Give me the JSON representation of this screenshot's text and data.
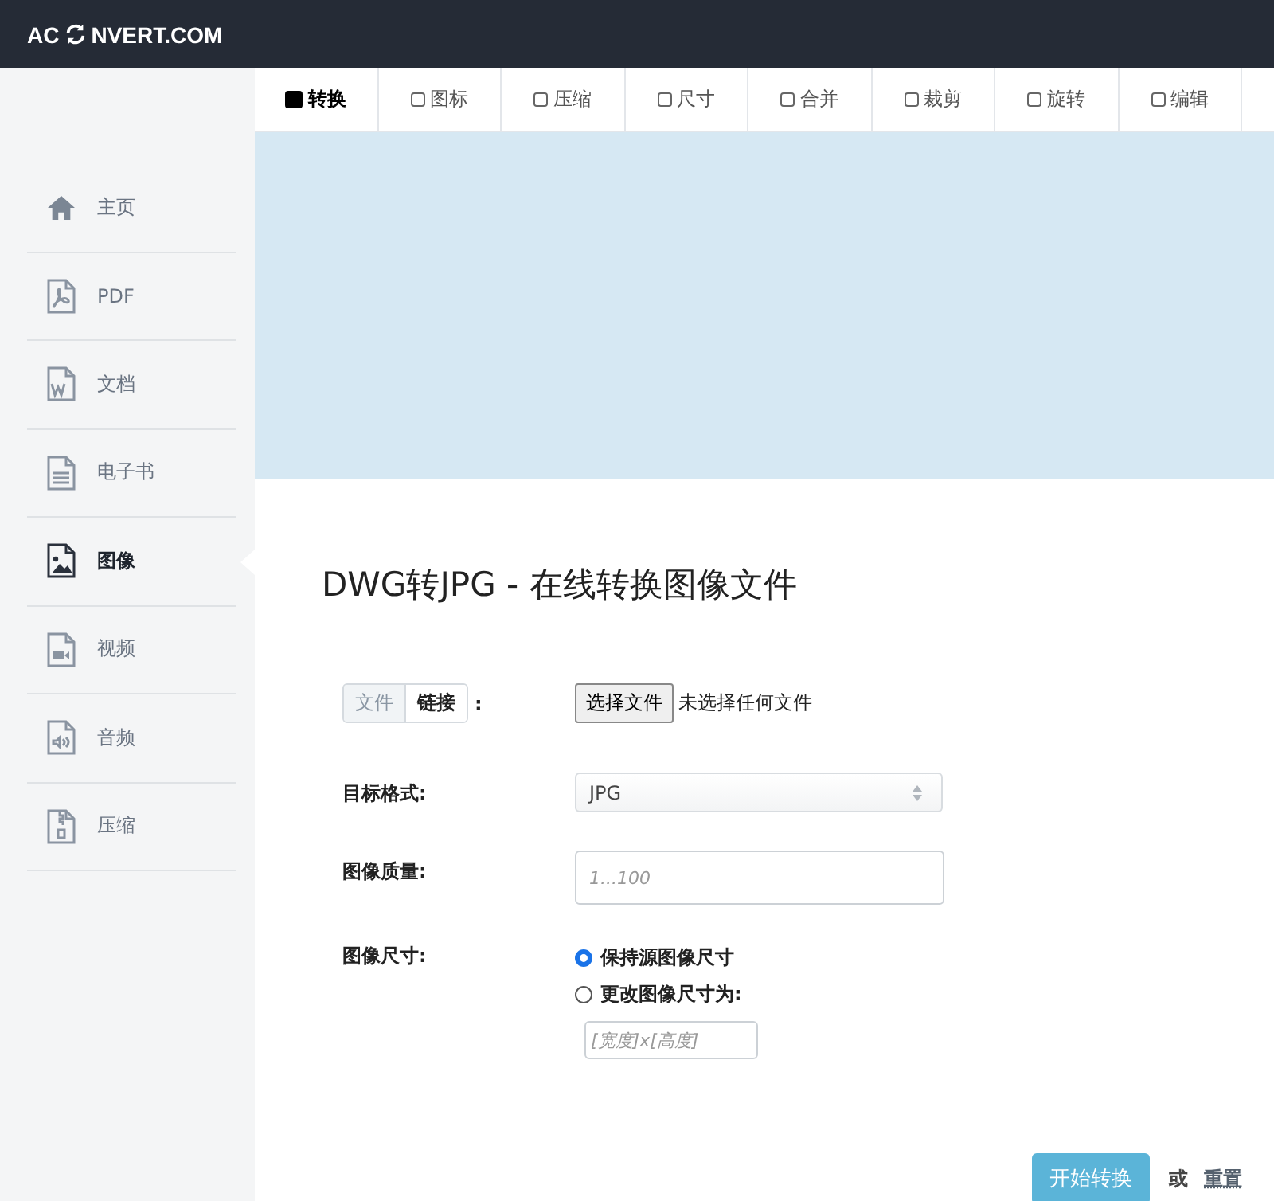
{
  "logo": {
    "before": "AC",
    "after": "NVERT.COM"
  },
  "tabs": [
    {
      "label": "转换",
      "selected": true
    },
    {
      "label": "图标",
      "selected": false
    },
    {
      "label": "压缩",
      "selected": false
    },
    {
      "label": "尺寸",
      "selected": false
    },
    {
      "label": "合并",
      "selected": false
    },
    {
      "label": "裁剪",
      "selected": false
    },
    {
      "label": "旋转",
      "selected": false
    },
    {
      "label": "编辑",
      "selected": false
    }
  ],
  "sidebar": {
    "items": [
      {
        "label": "主页",
        "kind": "home",
        "selected": false
      },
      {
        "label": "PDF",
        "kind": "pdf",
        "selected": false
      },
      {
        "label": "文档",
        "kind": "word",
        "selected": false
      },
      {
        "label": "电子书",
        "kind": "text",
        "selected": false
      },
      {
        "label": "图像",
        "kind": "image",
        "selected": true
      },
      {
        "label": "视频",
        "kind": "video",
        "selected": false
      },
      {
        "label": "音频",
        "kind": "audio",
        "selected": false
      },
      {
        "label": "压缩",
        "kind": "zip",
        "selected": false
      }
    ]
  },
  "heading": "DWG转JPG - 在线转换图像文件",
  "form": {
    "source": {
      "options": [
        {
          "label": "文件",
          "selected": true
        },
        {
          "label": "链接",
          "selected": false
        }
      ],
      "colon": ":",
      "button": "选择文件",
      "status": "未选择任何文件"
    },
    "format": {
      "label": "目标格式:",
      "value": "JPG"
    },
    "quality": {
      "label": "图像质量:",
      "placeholder": "1...100"
    },
    "size": {
      "label": "图像尺寸:",
      "options": [
        {
          "label": "保持源图像尺寸",
          "selected": true
        },
        {
          "label": "更改图像尺寸为:",
          "selected": false
        }
      ],
      "placeholder": "[宽度]x[高度]"
    }
  },
  "actions": {
    "submit": "开始转换",
    "or": "或",
    "reset": "重置"
  }
}
